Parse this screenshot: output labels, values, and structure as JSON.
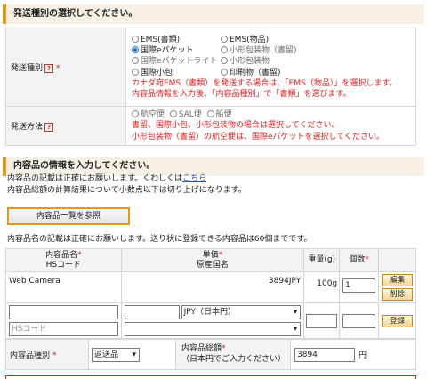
{
  "section1": {
    "title": "発送種別の選択してください。"
  },
  "shipping_type": {
    "label": "発送種別",
    "help": "?",
    "required": "*",
    "options": [
      {
        "label": "EMS(書類)",
        "checked": false,
        "disabled": false
      },
      {
        "label": "EMS(物品)",
        "checked": false,
        "disabled": false
      },
      {
        "label": "国際eパケット",
        "checked": true,
        "disabled": false
      },
      {
        "label": "小形包装物（書留)",
        "checked": false,
        "disabled": true
      },
      {
        "label": "国際eパケットライト",
        "checked": false,
        "disabled": true
      },
      {
        "label": "小形包装物",
        "checked": false,
        "disabled": true
      },
      {
        "label": "国際小包",
        "checked": false,
        "disabled": false
      },
      {
        "label": "印刷物（書留)",
        "checked": false,
        "disabled": false
      }
    ],
    "note1": "カナダ宛EMS（書類）を発送する場合は、「EMS（物品）」を選択します。",
    "note2": "内容品情報を入力後、「内容品種別」で「書類」を選びます。"
  },
  "shipping_method": {
    "label": "発送方法",
    "help": "?",
    "options": [
      {
        "label": "航空便",
        "checked": false
      },
      {
        "label": "SAL便",
        "checked": false
      },
      {
        "label": "船便",
        "checked": false
      }
    ],
    "note1": "書留、国際小包、小形包装物の場合は選択してください。",
    "note2": "小形包装物（書留）の航空便は、国際eパケットを選択してください。"
  },
  "section2": {
    "title": "内容品の情報を入力してください。",
    "line1_prefix": "内容品の記載は正確にお願いします。くわしくは",
    "line1_link": "こちら",
    "line2": "内容品総額の計算結果について小数点以下は切り上げになります。"
  },
  "browse_button": "内容品一覧を参照",
  "items_note": "内容品名の記載は正確にお願いします。送り状に登録できる内容品は60個までです。",
  "table": {
    "h_name1": "内容品名",
    "h_name2": "HSコード",
    "h_price1": "単価",
    "h_price2": "原産国名",
    "h_weight": "重量(g)",
    "h_qty": "個数",
    "req": "*",
    "row": {
      "name": "Web Camera",
      "price": "3894JPY",
      "weight": "100g",
      "qty": "1",
      "edit": "編集",
      "delete": "削除"
    },
    "new_row": {
      "hs_placeholder": "HSコード",
      "currency": "JPY（日本円）",
      "register": "登録"
    }
  },
  "summary": {
    "kind_label": "内容品種別",
    "kind_value": "返送品",
    "total_label1": "内容品総額",
    "total_label2": "（日本円でご入力ください）",
    "total_value": "3894",
    "unit": "円",
    "req": "*"
  }
}
